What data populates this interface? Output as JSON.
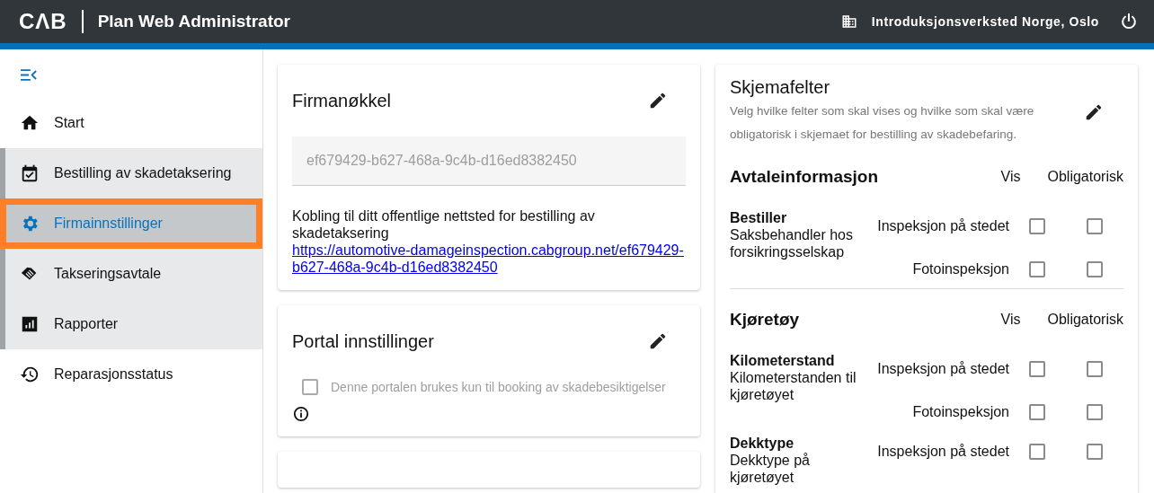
{
  "header": {
    "logo": "CΛB",
    "app_title": "Plan Web Administrator",
    "organization": "Introduksjonsverksted Norge, Oslo"
  },
  "sidebar": {
    "items": [
      {
        "label": "Start",
        "kind": "top",
        "selected": false
      },
      {
        "label": "Bestilling av skadetaksering",
        "kind": "group",
        "selected": false
      },
      {
        "label": "Firmainnstillinger",
        "kind": "group",
        "selected": true
      },
      {
        "label": "Takseringsavtale",
        "kind": "group",
        "selected": false
      },
      {
        "label": "Rapporter",
        "kind": "group",
        "selected": false
      },
      {
        "label": "Reparasjonsstatus",
        "kind": "top",
        "selected": false
      }
    ]
  },
  "company_key_card": {
    "title": "Firmanøkkel",
    "key": "ef679429-b627-468a-9c4b-d16ed8382450",
    "link_text": "Kobling til ditt offentlige nettsted for bestilling av skadetaksering",
    "link": "https://automotive-damageinspection.cabgroup.net/ef679429-b627-468a-9c4b-d16ed8382450"
  },
  "portal_card": {
    "title": "Portal innstillinger",
    "option": {
      "label": "Denne portalen brukes kun til booking av skadebesiktigelser",
      "checked": false,
      "disabled": true
    }
  },
  "form_fields_card": {
    "title": "Skjemafelter",
    "description": "Velg hvilke felter som skal vises og hvilke som skal være obligatorisk i skjemaet for bestilling av skadebefaring.",
    "sections": [
      {
        "title": "Avtaleinformasjon",
        "columns": [
          "Vis",
          "Obligatorisk"
        ],
        "fields": [
          {
            "name": "Bestiller",
            "description": "Saksbehandler hos forsikringsselskap",
            "options": [
              {
                "label": "Inspeksjon på stedet",
                "show": false,
                "required": false
              },
              {
                "label": "Fotoinspeksjon",
                "show": false,
                "required": false
              }
            ]
          }
        ]
      },
      {
        "title": "Kjøretøy",
        "columns": [
          "Vis",
          "Obligatorisk"
        ],
        "fields": [
          {
            "name": "Kilometerstand",
            "description": "Kilometerstanden til kjøretøyet",
            "options": [
              {
                "label": "Inspeksjon på stedet",
                "show": false,
                "required": false
              },
              {
                "label": "Fotoinspeksjon",
                "show": false,
                "required": false
              }
            ]
          },
          {
            "name": "Dekktype",
            "description": "Dekktype på kjøretøyet",
            "options": [
              {
                "label": "Inspeksjon på stedet",
                "show": false,
                "required": false
              }
            ]
          }
        ]
      }
    ]
  }
}
